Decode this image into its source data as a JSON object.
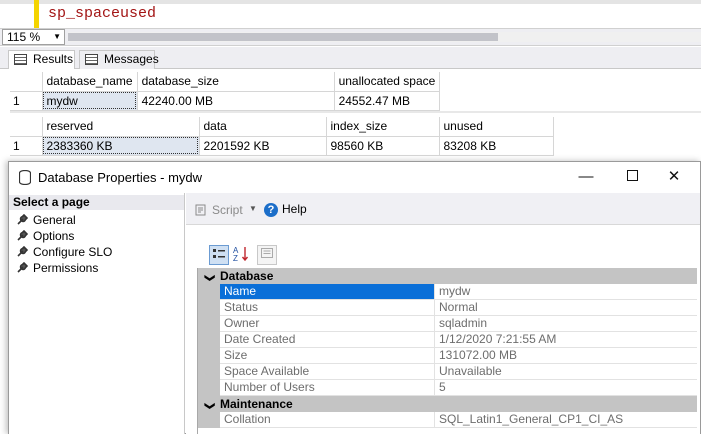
{
  "editor": {
    "code": "sp_spaceused"
  },
  "zoom": {
    "value": "115 %"
  },
  "result_tabs": [
    {
      "label": "Results"
    },
    {
      "label": "Messages"
    }
  ],
  "grid1": {
    "headers": [
      "database_name",
      "database_size",
      "unallocated space"
    ],
    "rows": [
      {
        "num": "1",
        "cells": [
          "mydw",
          "42240.00 MB",
          "24552.47 MB"
        ]
      }
    ]
  },
  "grid2": {
    "headers": [
      "reserved",
      "data",
      "index_size",
      "unused"
    ],
    "rows": [
      {
        "num": "1",
        "cells": [
          "2383360 KB",
          "2201592 KB",
          "98560 KB",
          "83208 KB"
        ]
      }
    ]
  },
  "dialog": {
    "title": "Database Properties - mydw",
    "select_page_label": "Select a page",
    "pages": [
      "General",
      "Options",
      "Configure SLO",
      "Permissions"
    ],
    "toolbar": {
      "script_label": "Script",
      "help_label": "Help"
    },
    "categories": [
      {
        "name": "Database",
        "properties": [
          {
            "key": "Name",
            "value": "mydw",
            "selected": true
          },
          {
            "key": "Status",
            "value": "Normal"
          },
          {
            "key": "Owner",
            "value": "sqladmin"
          },
          {
            "key": "Date Created",
            "value": "1/12/2020 7:21:55 AM"
          },
          {
            "key": "Size",
            "value": "131072.00 MB"
          },
          {
            "key": "Space Available",
            "value": "Unavailable"
          },
          {
            "key": "Number of Users",
            "value": "5"
          }
        ]
      },
      {
        "name": "Maintenance",
        "properties": [
          {
            "key": "Collation",
            "value": "SQL_Latin1_General_CP1_CI_AS"
          }
        ]
      }
    ]
  },
  "colors": {
    "selection_blue": "#0a6fd8",
    "code_red": "#a31515",
    "gutter_yellow": "#f4d400"
  }
}
